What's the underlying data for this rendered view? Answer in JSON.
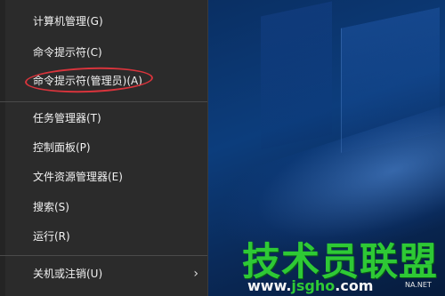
{
  "context_menu": {
    "items": [
      {
        "label": "计算机管理(G)"
      },
      {
        "label": "命令提示符(C)"
      },
      {
        "label": "命令提示符(管理员)(A)"
      },
      {
        "label": "任务管理器(T)"
      },
      {
        "label": "控制面板(P)"
      },
      {
        "label": "文件资源管理器(E)"
      },
      {
        "label": "搜索(S)"
      },
      {
        "label": "运行(R)"
      },
      {
        "label": "关机或注销(U)",
        "submenu_arrow": "›"
      }
    ]
  },
  "watermark": {
    "title": "技术员联盟",
    "url_prefix": "www.",
    "url_main": "jsgho",
    "url_suffix": ".com",
    "small_text": "NA.NET"
  }
}
